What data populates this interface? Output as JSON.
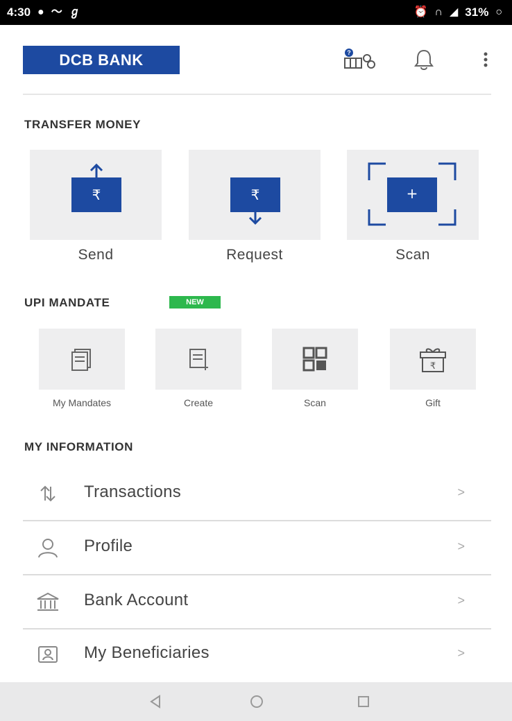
{
  "status_bar": {
    "time": "4:30",
    "battery": "31%"
  },
  "header": {
    "logo_text": "DCB BANK",
    "icons": [
      "support-icon",
      "bell-icon",
      "more-vert-icon"
    ]
  },
  "transfer_money": {
    "title": "TRANSFER MONEY",
    "items": [
      {
        "label": "Send",
        "icon": "send-money-icon"
      },
      {
        "label": "Request",
        "icon": "request-money-icon"
      },
      {
        "label": "Scan",
        "icon": "scan-qr-icon"
      }
    ]
  },
  "upi_mandate": {
    "title": "UPI MANDATE",
    "badge": "NEW",
    "items": [
      {
        "label": "My Mandates",
        "icon": "mandates-icon"
      },
      {
        "label": "Create",
        "icon": "create-mandate-icon"
      },
      {
        "label": "Scan",
        "icon": "qr-code-icon"
      },
      {
        "label": "Gift",
        "icon": "gift-icon"
      }
    ]
  },
  "my_information": {
    "title": "MY INFORMATION",
    "items": [
      {
        "label": "Transactions",
        "icon": "transactions-icon"
      },
      {
        "label": "Profile",
        "icon": "profile-icon"
      },
      {
        "label": "Bank Account",
        "icon": "bank-icon"
      },
      {
        "label": "My Beneficiaries",
        "icon": "beneficiaries-icon"
      }
    ],
    "chevron": ">"
  },
  "nav_bar": {
    "buttons": [
      "back-icon",
      "home-icon",
      "recents-icon"
    ]
  },
  "colors": {
    "brand_blue": "#1d4aa1",
    "tile_bg": "#eeeeef",
    "badge_green": "#2db84d"
  }
}
